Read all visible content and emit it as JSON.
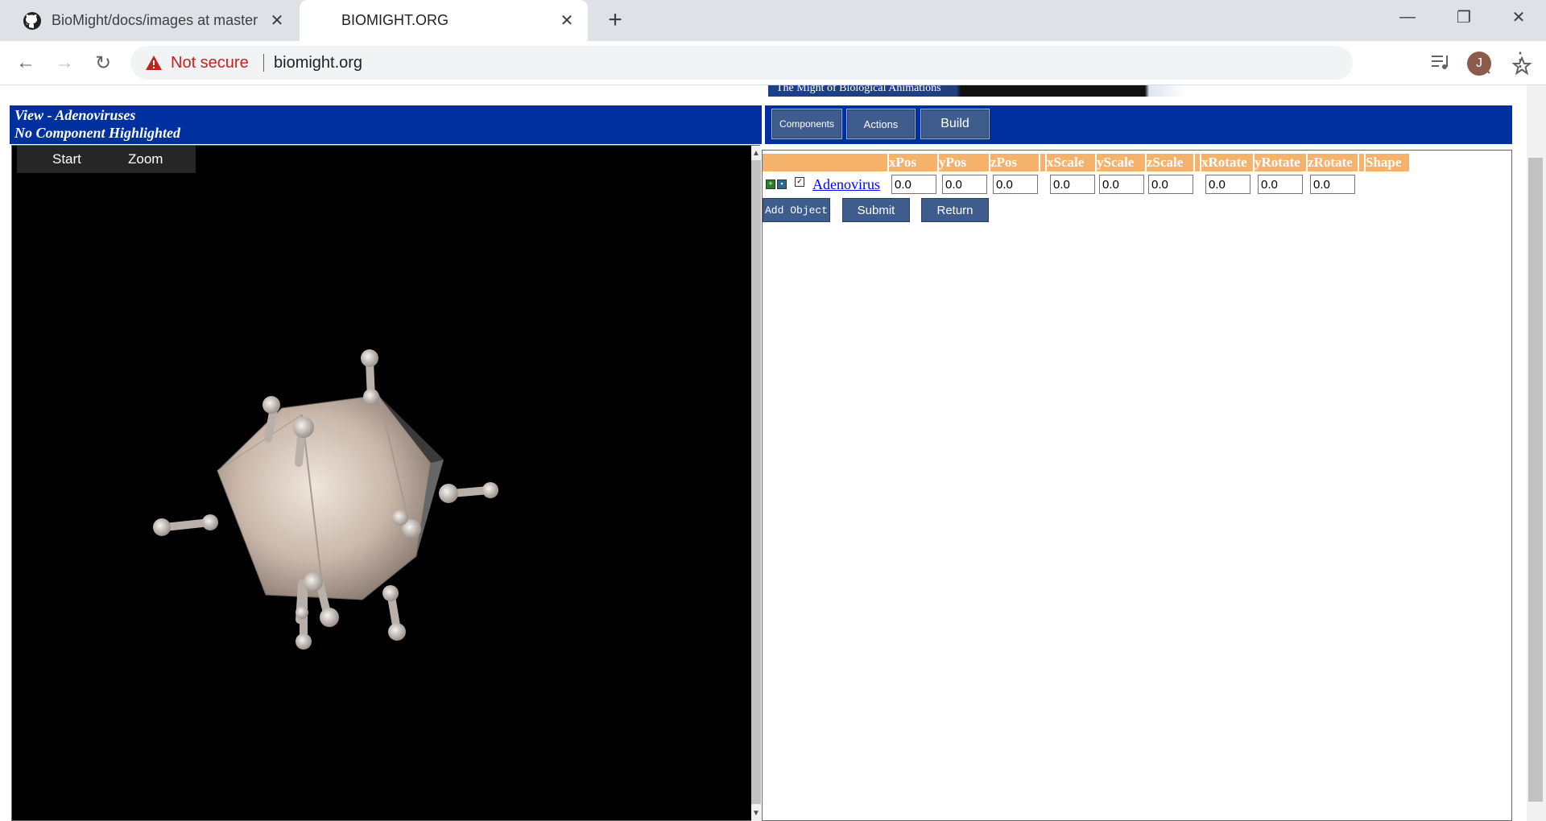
{
  "browser": {
    "tabs": [
      {
        "title": "BioMight/docs/images at master",
        "icon": "github-icon"
      },
      {
        "title": "BIOMIGHT.ORG",
        "icon": "globe-icon"
      }
    ],
    "security_label": "Not secure",
    "url": "biomight.org",
    "profile_initial": "J"
  },
  "page": {
    "banner_text": "The Might of Biological Animations",
    "view_title": "View - Adenoviruses",
    "view_subtitle": "No Component Highlighted",
    "buttons": {
      "components": "Components",
      "actions": "Actions",
      "build": "Build"
    },
    "viewer_menu": {
      "start": "Start",
      "zoom": "Zoom"
    },
    "table_headers": [
      "xPos",
      "yPos",
      "zPos",
      "xScale",
      "yScale",
      "zScale",
      "xRotate",
      "yRotate",
      "zRotate",
      "Shape"
    ],
    "row": {
      "name": "Adenovirus",
      "values": [
        "0.0",
        "0.0",
        "0.0",
        "0.0",
        "0.0",
        "0.0",
        "0.0",
        "0.0",
        "0.0"
      ]
    },
    "form_buttons": {
      "add_object": "Add Object",
      "submit": "Submit",
      "return": "Return"
    }
  },
  "colors": {
    "header_blue": "#002f9f",
    "table_header_orange": "#f5b26b",
    "button_blue": "#3f5d8c"
  }
}
